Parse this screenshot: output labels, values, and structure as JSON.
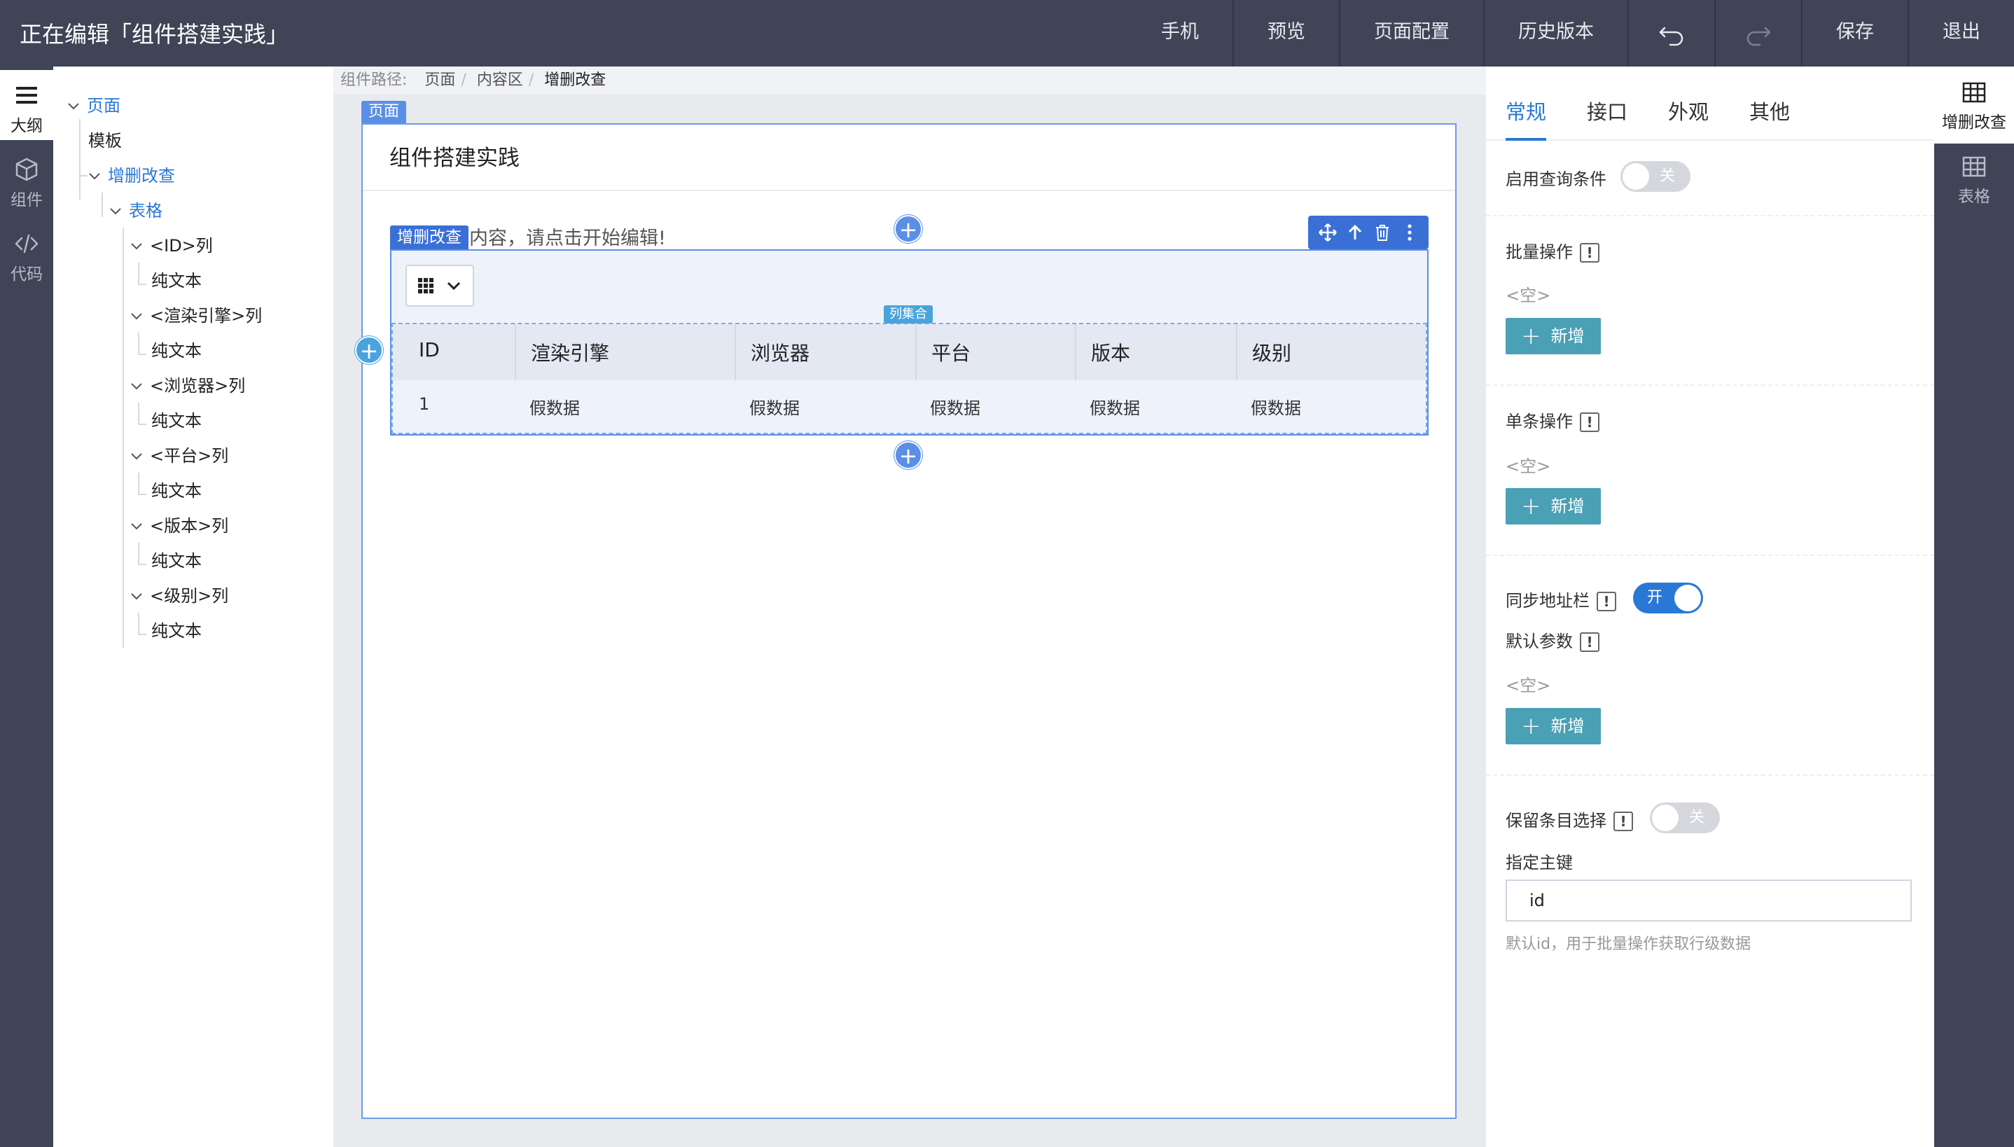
{
  "topbar": {
    "title": "正在编辑「组件搭建实践」",
    "nav": {
      "mobile": "手机",
      "preview": "预览",
      "page_config": "页面配置",
      "history": "历史版本",
      "undo_icon": "undo-icon",
      "redo_icon": "redo-icon",
      "save": "保存",
      "exit": "退出"
    }
  },
  "left_rail": {
    "outline": "大纲",
    "components": "组件",
    "code": "代码"
  },
  "outline": {
    "page": "页面",
    "template": "模板",
    "crud": "增删改查",
    "table": "表格",
    "items": [
      {
        "label": "<ID>列",
        "child": "纯文本"
      },
      {
        "label": "<渲染引擎>列",
        "child": "纯文本"
      },
      {
        "label": "<浏览器>列",
        "child": "纯文本"
      },
      {
        "label": "<平台>列",
        "child": "纯文本"
      },
      {
        "label": "<版本>列",
        "child": "纯文本"
      },
      {
        "label": "<级别>列",
        "child": "纯文本"
      }
    ]
  },
  "breadcrumb": {
    "prefix": "组件路径:",
    "items": [
      "页面",
      "内容区",
      "增删改查"
    ]
  },
  "canvas": {
    "page_tag": "页面",
    "page_title": "组件搭建实践",
    "crud_tag": "增删改查",
    "hint": "内容，请点击开始编辑!",
    "column_set_tag": "列集合",
    "table": {
      "columns": [
        "ID",
        "渲染引擎",
        "浏览器",
        "平台",
        "版本",
        "级别"
      ],
      "rows": [
        [
          "1",
          "假数据",
          "假数据",
          "假数据",
          "假数据",
          "假数据"
        ]
      ]
    }
  },
  "props": {
    "tabs": [
      "常规",
      "接口",
      "外观",
      "其他"
    ],
    "active_tab": "常规",
    "enable_query": {
      "label": "启用查询条件",
      "toggle": "关",
      "on": false
    },
    "bulk_actions": {
      "label": "批量操作",
      "empty": "<空>",
      "add": "新增"
    },
    "item_actions": {
      "label": "单条操作",
      "empty": "<空>",
      "add": "新增"
    },
    "sync_location": {
      "label": "同步地址栏",
      "toggle": "开",
      "on": true
    },
    "default_params": {
      "label": "默认参数",
      "empty": "<空>",
      "add": "新增"
    },
    "keep_selection": {
      "label": "保留条目选择",
      "toggle": "关",
      "on": false
    },
    "primary_key": {
      "label": "指定主键",
      "value": "id",
      "help": "默认id，用于批量操作获取行级数据"
    }
  },
  "right_rail": {
    "crud": "增删改查",
    "table": "表格"
  },
  "colors": {
    "chrome": "#3f4456",
    "accent": "#2a78d6",
    "selection": "#5b8fe6",
    "add_button": "#4aa0b5"
  }
}
